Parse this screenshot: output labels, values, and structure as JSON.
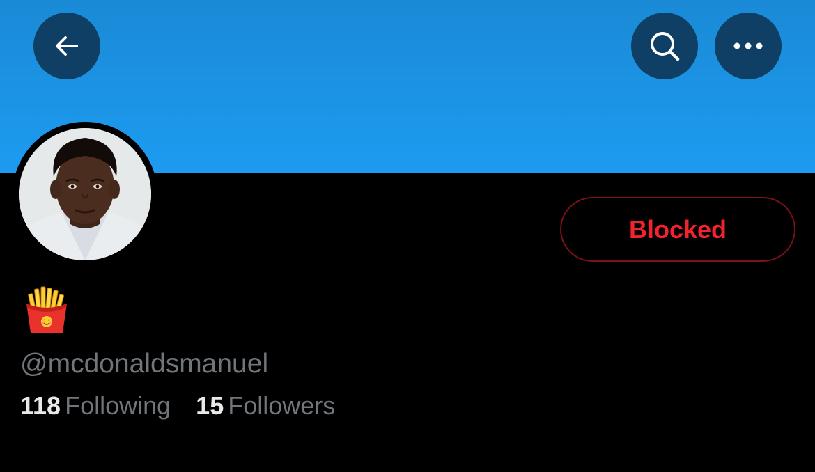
{
  "profile": {
    "display_name_icon": "french-fries-emoji",
    "handle": "@mcdonaldsmanuel",
    "following_count": "118",
    "following_label": "Following",
    "followers_count": "15",
    "followers_label": "Followers"
  },
  "actions": {
    "blocked_label": "Blocked"
  },
  "header": {
    "back_icon": "arrow-left-icon",
    "search_icon": "search-icon",
    "more_icon": "more-horizontal-icon"
  },
  "colors": {
    "banner": "#1d9bf0",
    "header_button_bg": "#0f3f64",
    "blocked_text": "#f4212e",
    "blocked_border": "#7c1117",
    "secondary_text": "#71767b",
    "primary_text": "#e7e9ea",
    "background": "#000000"
  }
}
